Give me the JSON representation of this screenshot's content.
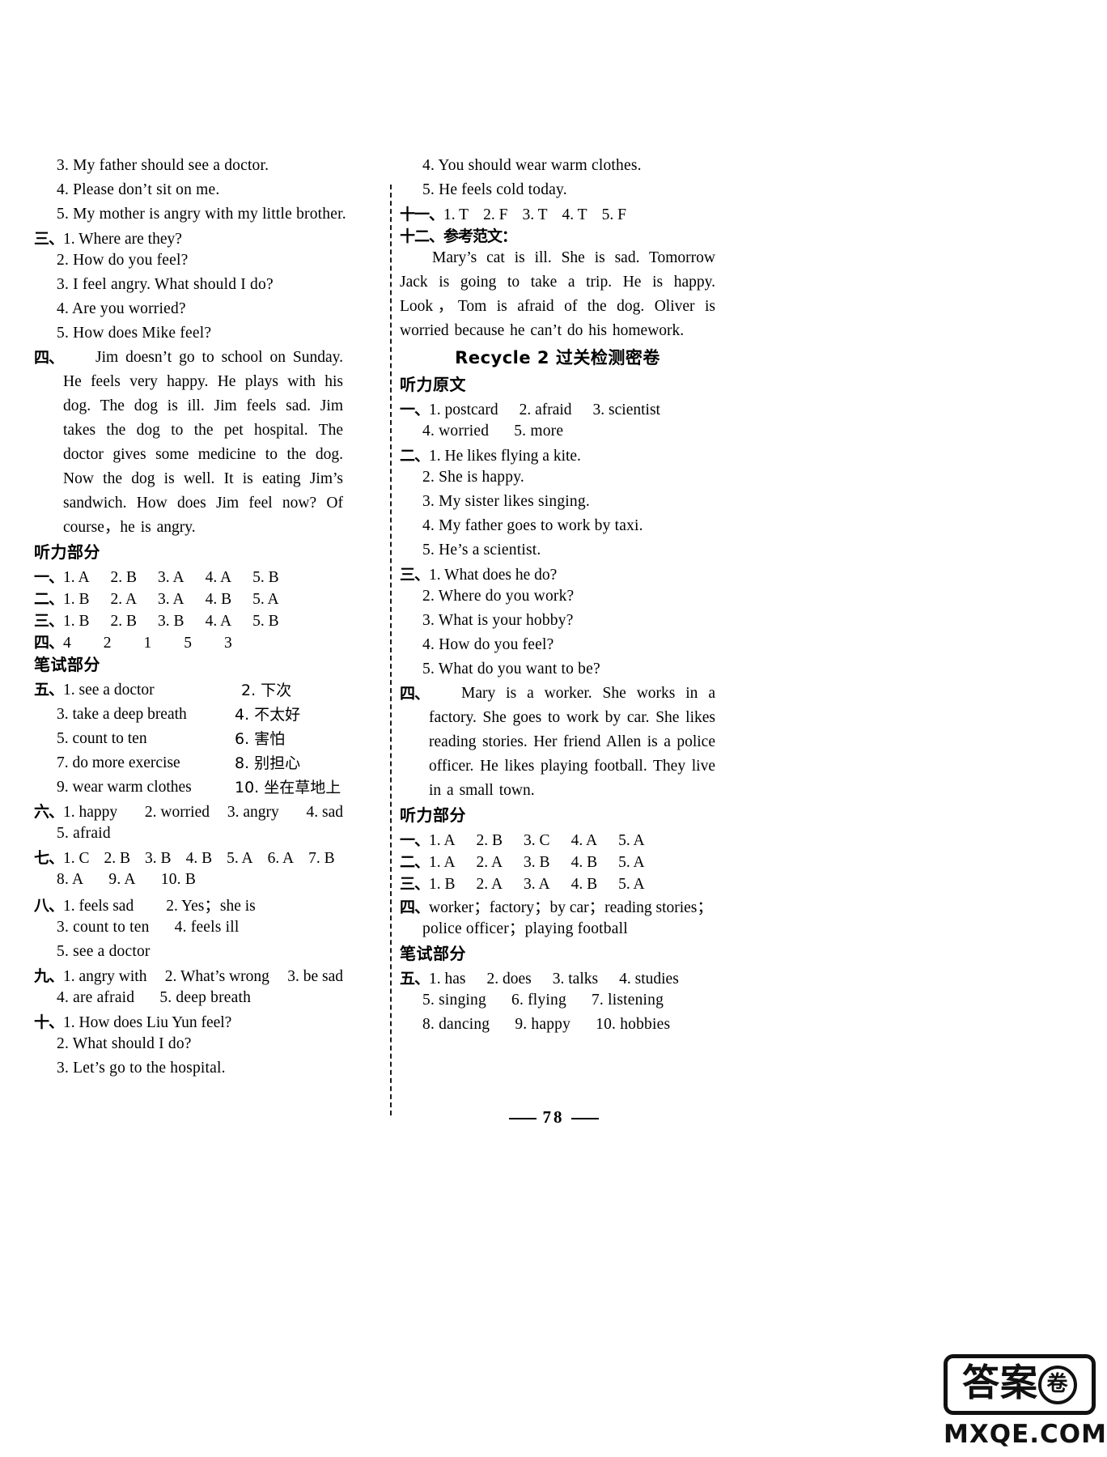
{
  "page": {
    "number": "78",
    "watermark": {
      "top": "答案",
      "badge": "卷",
      "bottom": "MXQE.COM"
    }
  },
  "left_column": {
    "listening_script_tail": {
      "items": [
        "3. My father should see a doctor.",
        "4. Please don’t sit on me.",
        "5. My mother is angry with my little brother."
      ]
    },
    "section_three": {
      "marker": "三、",
      "items": [
        "1. Where are they?",
        "2. How do you feel?",
        "3. I feel angry.  What should I do?",
        "4. Are you worried?",
        "5. How does Mike feel?"
      ]
    },
    "section_four": {
      "marker": "四、",
      "paragraph": "Jim doesn’t go to school on Sunday. He feels very happy. He plays with his dog. The dog is ill. Jim feels sad. Jim takes the dog to the pet hospital. The doctor gives some medicine to the dog. Now the dog is well. It is eating Jim’s sandwich. How does Jim feel now? Of course，he is angry."
    },
    "listening_part": {
      "heading": "听力部分",
      "rows": [
        {
          "marker": "一、",
          "answers": [
            "1. A",
            "2. B",
            "3. A",
            "4. A",
            "5. B"
          ]
        },
        {
          "marker": "二、",
          "answers": [
            "1. B",
            "2. A",
            "3. A",
            "4. B",
            "5. A"
          ]
        },
        {
          "marker": "三、",
          "answers": [
            "1. B",
            "2. B",
            "3. B",
            "4. A",
            "5. B"
          ]
        },
        {
          "marker": "四、",
          "answers": [
            "4",
            "2",
            "1",
            "5",
            "3"
          ]
        }
      ]
    },
    "written_part": {
      "heading": "笔试部分",
      "section_five": {
        "marker": "五、",
        "pairs": [
          {
            "left": "1. see a doctor",
            "right": "2. 下次"
          },
          {
            "left": "3. take a deep breath",
            "right": "4. 不太好"
          },
          {
            "left": "5. count to ten",
            "right": "6. 害怕"
          },
          {
            "left": "7. do more exercise",
            "right": "8. 别担心"
          },
          {
            "left": "9. wear warm clothes",
            "right": "10. 坐在草地上"
          }
        ]
      },
      "section_six": {
        "marker": "六、",
        "line1": [
          "1. happy",
          "2. worried",
          "3. angry",
          "4. sad"
        ],
        "line2": [
          "5. afraid"
        ]
      },
      "section_seven": {
        "marker": "七、",
        "line1": [
          "1. C",
          "2. B",
          "3. B",
          "4. B",
          "5. A",
          "6. A",
          "7. B"
        ],
        "line2": [
          "8. A",
          "9. A",
          "10. B"
        ]
      },
      "section_eight": {
        "marker": "八、",
        "line1": [
          "1. feels sad",
          "2. Yes；she is"
        ],
        "line2": [
          "3. count to ten",
          "4. feels ill"
        ],
        "line3": [
          "5. see a doctor"
        ]
      },
      "section_nine": {
        "marker": "九、",
        "line1": [
          "1. angry with",
          "2. What’s wrong",
          "3. be sad"
        ],
        "line2": [
          "4. are afraid",
          "5. deep breath"
        ]
      },
      "section_ten": {
        "marker": "十、",
        "items": [
          "1. How does Liu Yun feel?",
          "2. What should I do?",
          "3. Let’s go to the hospital."
        ]
      }
    }
  },
  "right_column": {
    "script_tail": {
      "items": [
        "4. You should wear warm clothes.",
        "5. He feels cold today."
      ]
    },
    "section_eleven": {
      "marker": "十一、",
      "answers": [
        "1. T",
        "2. F",
        "3. T",
        "4. T",
        "5. F"
      ]
    },
    "section_twelve": {
      "marker": "十二、",
      "label": "参考范文：",
      "paragraph": "Mary’s cat is ill. She is sad. Tomorrow Jack is going to take a trip. He is happy. Look，Tom is afraid of the dog. Oliver is worried because he can’t do his homework."
    },
    "recycle_title": "Recycle 2 过关检测密卷",
    "listening_script": {
      "heading": "听力原文",
      "section_one": {
        "marker": "一、",
        "line1": [
          "1. postcard",
          "2. afraid",
          "3. scientist"
        ],
        "line2": [
          "4. worried",
          "5. more"
        ]
      },
      "section_two": {
        "marker": "二、",
        "items": [
          "1. He likes flying a kite.",
          "2. She is happy.",
          "3. My sister likes singing.",
          "4. My father goes to work by taxi.",
          "5. He’s a scientist."
        ]
      },
      "section_three": {
        "marker": "三、",
        "items": [
          "1. What does he do?",
          "2. Where do you work?",
          "3. What is your hobby?",
          "4. How do you feel?",
          "5. What do you want to be?"
        ]
      },
      "section_four": {
        "marker": "四、",
        "paragraph": "Mary is a worker. She works in a factory. She goes to work by car. She likes reading stories. Her friend Allen is a police officer. He likes playing football. They live in a small town."
      }
    },
    "listening_part": {
      "heading": "听力部分",
      "rows": [
        {
          "marker": "一、",
          "answers": [
            "1. A",
            "2. B",
            "3. C",
            "4. A",
            "5. A"
          ]
        },
        {
          "marker": "二、",
          "answers": [
            "1. A",
            "2. A",
            "3. B",
            "4. B",
            "5. A"
          ]
        },
        {
          "marker": "三、",
          "answers": [
            "1. B",
            "2. A",
            "3. A",
            "4. B",
            "5. A"
          ]
        }
      ],
      "section_four": {
        "marker": "四、",
        "line1": "worker；factory；by car；reading stories；",
        "line2": "police officer；playing football"
      }
    },
    "written_part": {
      "heading": "笔试部分",
      "section_five": {
        "marker": "五、",
        "line1": [
          "1. has",
          "2. does",
          "3. talks",
          "4. studies"
        ],
        "line2": [
          "5. singing",
          "6. flying",
          "7. listening"
        ],
        "line3": [
          "8. dancing",
          "9. happy",
          "10. hobbies"
        ]
      }
    }
  }
}
